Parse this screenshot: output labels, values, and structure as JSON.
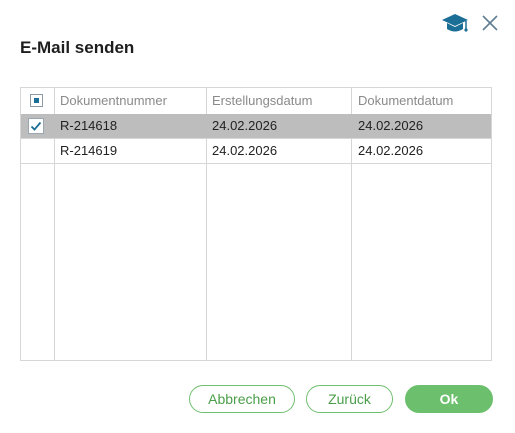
{
  "dialog": {
    "title": "E-Mail senden",
    "icons": {
      "help": "graduation-cap-icon",
      "close": "close-icon"
    },
    "accent_color": "#1b6e96"
  },
  "table": {
    "columns": [
      "Dokumentnummer",
      "Erstellungsdatum",
      "Dokumentdatum"
    ],
    "rows": [
      {
        "selected": true,
        "cells": [
          "R-214618",
          "24.02.2026",
          "24.02.2026"
        ]
      },
      {
        "selected": false,
        "cells": [
          "R-214619",
          "24.02.2026",
          "24.02.2026"
        ]
      }
    ],
    "select_all_state": "partial"
  },
  "buttons": {
    "cancel": "Abbrechen",
    "back": "Zurück",
    "ok": "Ok"
  },
  "colors": {
    "selected_row": "#bdbdbd",
    "button_green": "#6cbf6c"
  }
}
